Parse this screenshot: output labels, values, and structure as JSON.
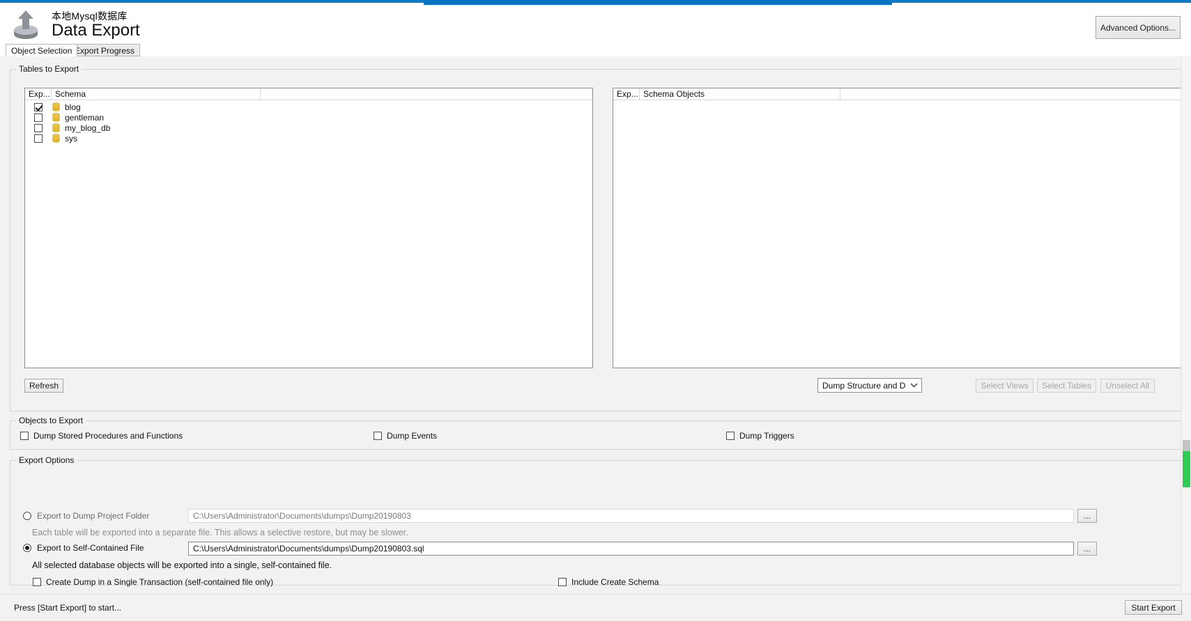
{
  "window": {
    "subtitle": "本地Mysql数据库",
    "title": "Data Export",
    "advanced_options_label": "Advanced Options...",
    "accent_color": "#0f7ac7"
  },
  "tabs": [
    {
      "label": "Object Selection",
      "active": true
    },
    {
      "label": "Export Progress",
      "active": false
    }
  ],
  "tables_to_export": {
    "group_title": "Tables to Export",
    "left_panel": {
      "columns": [
        "Exp...",
        "Schema",
        ""
      ],
      "rows": [
        {
          "checked": true,
          "label": "blog"
        },
        {
          "checked": false,
          "label": "gentleman"
        },
        {
          "checked": false,
          "label": "my_blog_db"
        },
        {
          "checked": false,
          "label": "sys"
        }
      ]
    },
    "right_panel": {
      "columns": [
        "Exp...",
        "Schema Objects",
        ""
      ],
      "rows": []
    },
    "refresh_label": "Refresh",
    "dump_select": {
      "value": "Dump Structure and Da",
      "chevron": "chevron-down-icon"
    },
    "select_views_label": "Select Views",
    "select_tables_label": "Select Tables",
    "unselect_all_label": "Unselect All"
  },
  "objects_to_export": {
    "group_title": "Objects to Export",
    "checkboxes": [
      {
        "label": "Dump Stored Procedures and Functions",
        "checked": false
      },
      {
        "label": "Dump Events",
        "checked": false
      },
      {
        "label": "Dump Triggers",
        "checked": false
      }
    ]
  },
  "export_options": {
    "group_title": "Export Options",
    "dump_project_folder": {
      "label": "Export to Dump Project Folder",
      "selected": false,
      "path": "C:\\Users\\Administrator\\Documents\\dumps\\Dump20190803",
      "hint": "Each table will be exported into a separate file. This allows a selective restore, but may be slower.",
      "browse_label": "..."
    },
    "self_contained_file": {
      "label": "Export to Self-Contained File",
      "selected": true,
      "path": "C:\\Users\\Administrator\\Documents\\dumps\\Dump20190803.sql",
      "hint": "All selected database objects will be exported into a single, self-contained file.",
      "browse_label": "..."
    },
    "single_transaction": {
      "label": "Create Dump in a Single Transaction (self-contained file only)",
      "checked": false
    },
    "include_create_schema": {
      "label": "Include Create Schema",
      "checked": false
    }
  },
  "footer": {
    "status": "Press [Start Export] to start...",
    "start_export_label": "Start Export"
  }
}
